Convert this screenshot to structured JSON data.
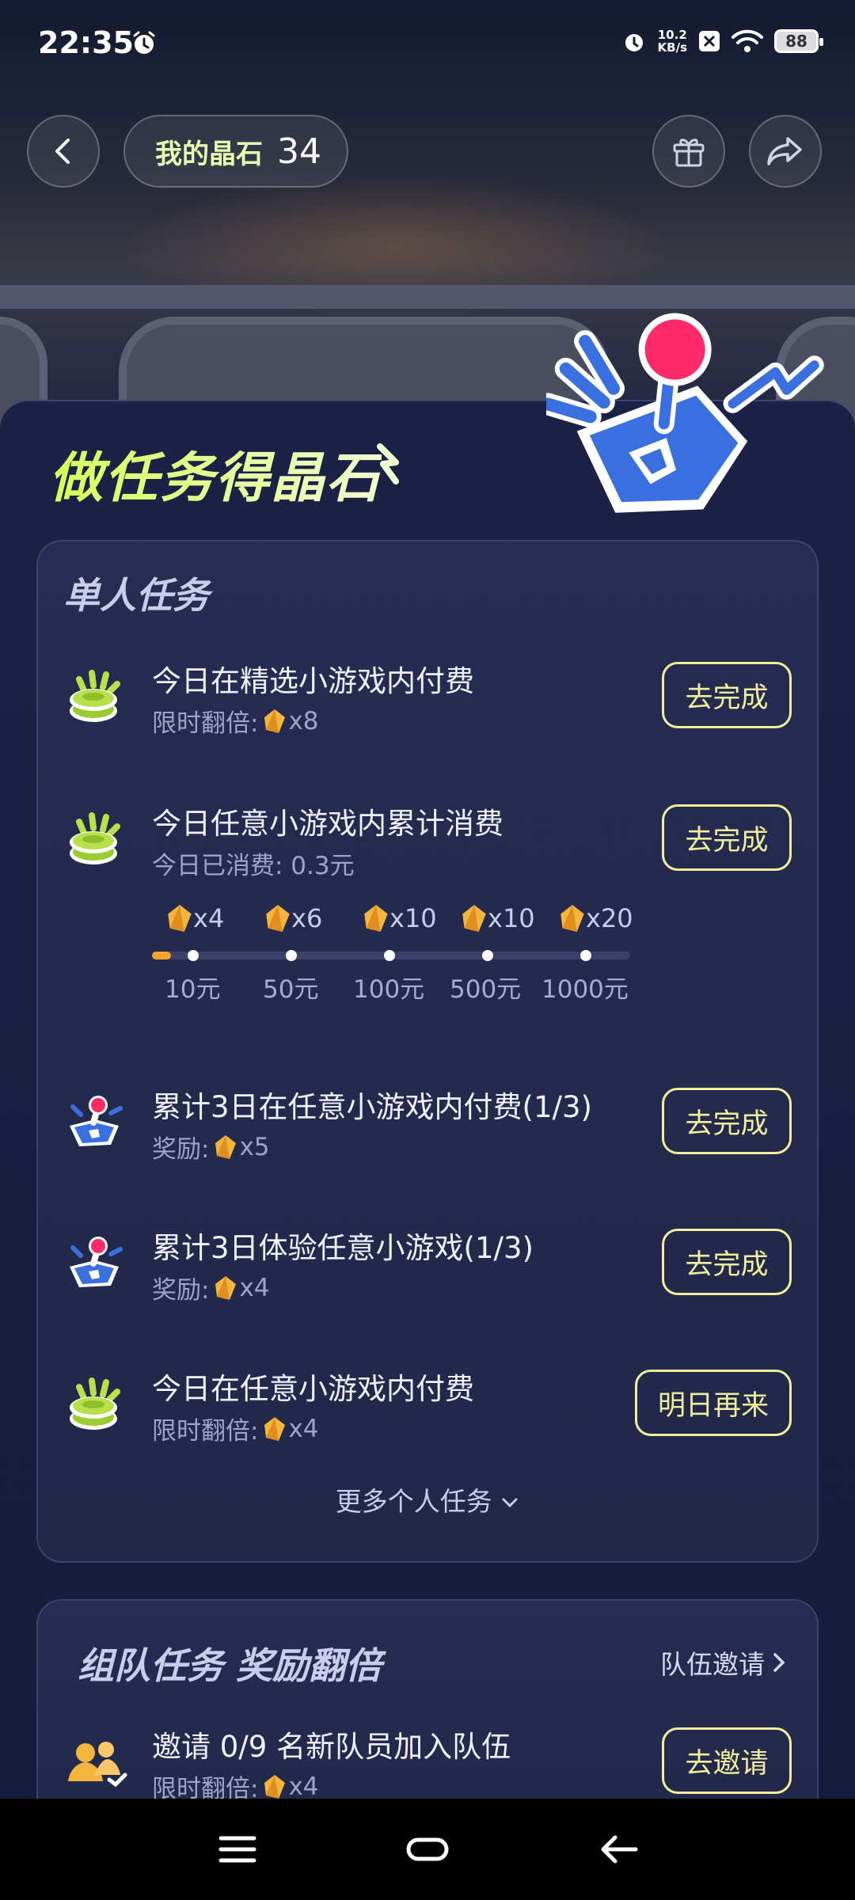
{
  "status_bar": {
    "time": "22:35",
    "net_speed_value": "10.2",
    "net_speed_unit": "KB/s",
    "battery": "88"
  },
  "header": {
    "crystal_label": "我的晶石",
    "crystal_count": "34"
  },
  "panel": {
    "title": "做任务得晶石"
  },
  "single_tasks": {
    "section_title": "单人任务",
    "items": [
      {
        "title": "今日在精选小游戏内付费",
        "sub_label": "限时翻倍:",
        "reward": "x8",
        "button": "去完成",
        "icon": "coin-stack-icon"
      },
      {
        "title": "今日任意小游戏内累计消费",
        "sub_label": "今日已消费: 0.3元",
        "reward": "",
        "button": "去完成",
        "icon": "coin-stack-icon"
      },
      {
        "title": "累计3日在任意小游戏内付费(1/3)",
        "sub_label": "奖励:",
        "reward": "x5",
        "button": "去完成",
        "icon": "joystick-icon"
      },
      {
        "title": "累计3日体验任意小游戏(1/3)",
        "sub_label": "奖励:",
        "reward": "x4",
        "button": "去完成",
        "icon": "joystick-icon"
      },
      {
        "title": "今日在任意小游戏内付费",
        "sub_label": "限时翻倍:",
        "reward": "x4",
        "button": "明日再来",
        "icon": "coin-stack-icon"
      }
    ],
    "progress": {
      "filled_fraction": 0.03,
      "milestones": [
        {
          "reward": "x4",
          "amount": "10元"
        },
        {
          "reward": "x6",
          "amount": "50元"
        },
        {
          "reward": "x10",
          "amount": "100元"
        },
        {
          "reward": "x10",
          "amount": "500元"
        },
        {
          "reward": "x20",
          "amount": "1000元"
        }
      ]
    },
    "more_link": "更多个人任务"
  },
  "team_tasks": {
    "section_title": "组队任务 奖励翻倍",
    "invite_link": "队伍邀请",
    "items": [
      {
        "title": "邀请 0/9 名新队员加入队伍",
        "sub_label": "限时翻倍:",
        "reward": "x4",
        "button": "去邀请",
        "icon": "team-people-icon"
      }
    ]
  },
  "colors": {
    "accent_yellow": "#f0ef9c",
    "title_green": "#d6ff5a",
    "panel_bg": "#1c2146",
    "progress_fill": "#f7a42f"
  }
}
